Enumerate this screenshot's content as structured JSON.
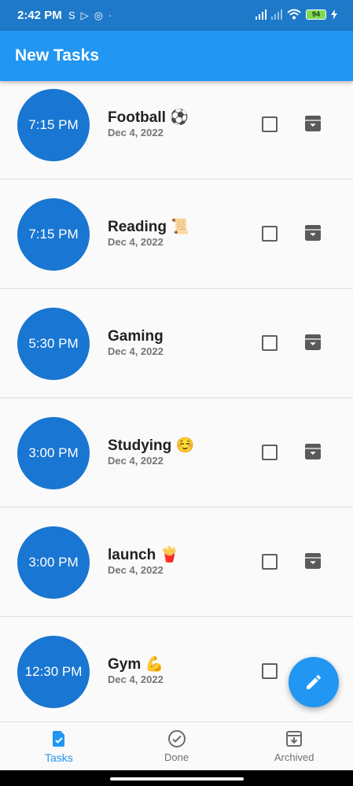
{
  "status_bar": {
    "time": "2:42 PM",
    "left_icons": [
      "sync-icon",
      "play-store-icon",
      "instagram-icon",
      "dot-icon"
    ],
    "battery": "94"
  },
  "app_bar": {
    "title": "New Tasks"
  },
  "tasks": [
    {
      "time": "7:15 PM",
      "title": "Football ⚽",
      "date": "Dec 4, 2022"
    },
    {
      "time": "7:15 PM",
      "title": "Reading 📜",
      "date": "Dec 4, 2022"
    },
    {
      "time": "5:30 PM",
      "title": "Gaming",
      "date": "Dec 4, 2022"
    },
    {
      "time": "3:00 PM",
      "title": "Studying ☺️",
      "date": "Dec 4, 2022"
    },
    {
      "time": "3:00 PM",
      "title": "launch 🍟",
      "date": "Dec 4, 2022"
    },
    {
      "time": "12:30 PM",
      "title": "Gym 💪",
      "date": "Dec 4, 2022"
    }
  ],
  "fab": {
    "icon": "edit-icon"
  },
  "bottom_nav": [
    {
      "label": "Tasks",
      "icon": "task-icon",
      "active": true
    },
    {
      "label": "Done",
      "icon": "check-circle-icon",
      "active": false
    },
    {
      "label": "Archived",
      "icon": "archive-icon",
      "active": false
    }
  ],
  "colors": {
    "status_bar": "#1e79c9",
    "app_bar": "#2196f3",
    "time_circle": "#1976d2",
    "active_nav": "#2196f3"
  }
}
